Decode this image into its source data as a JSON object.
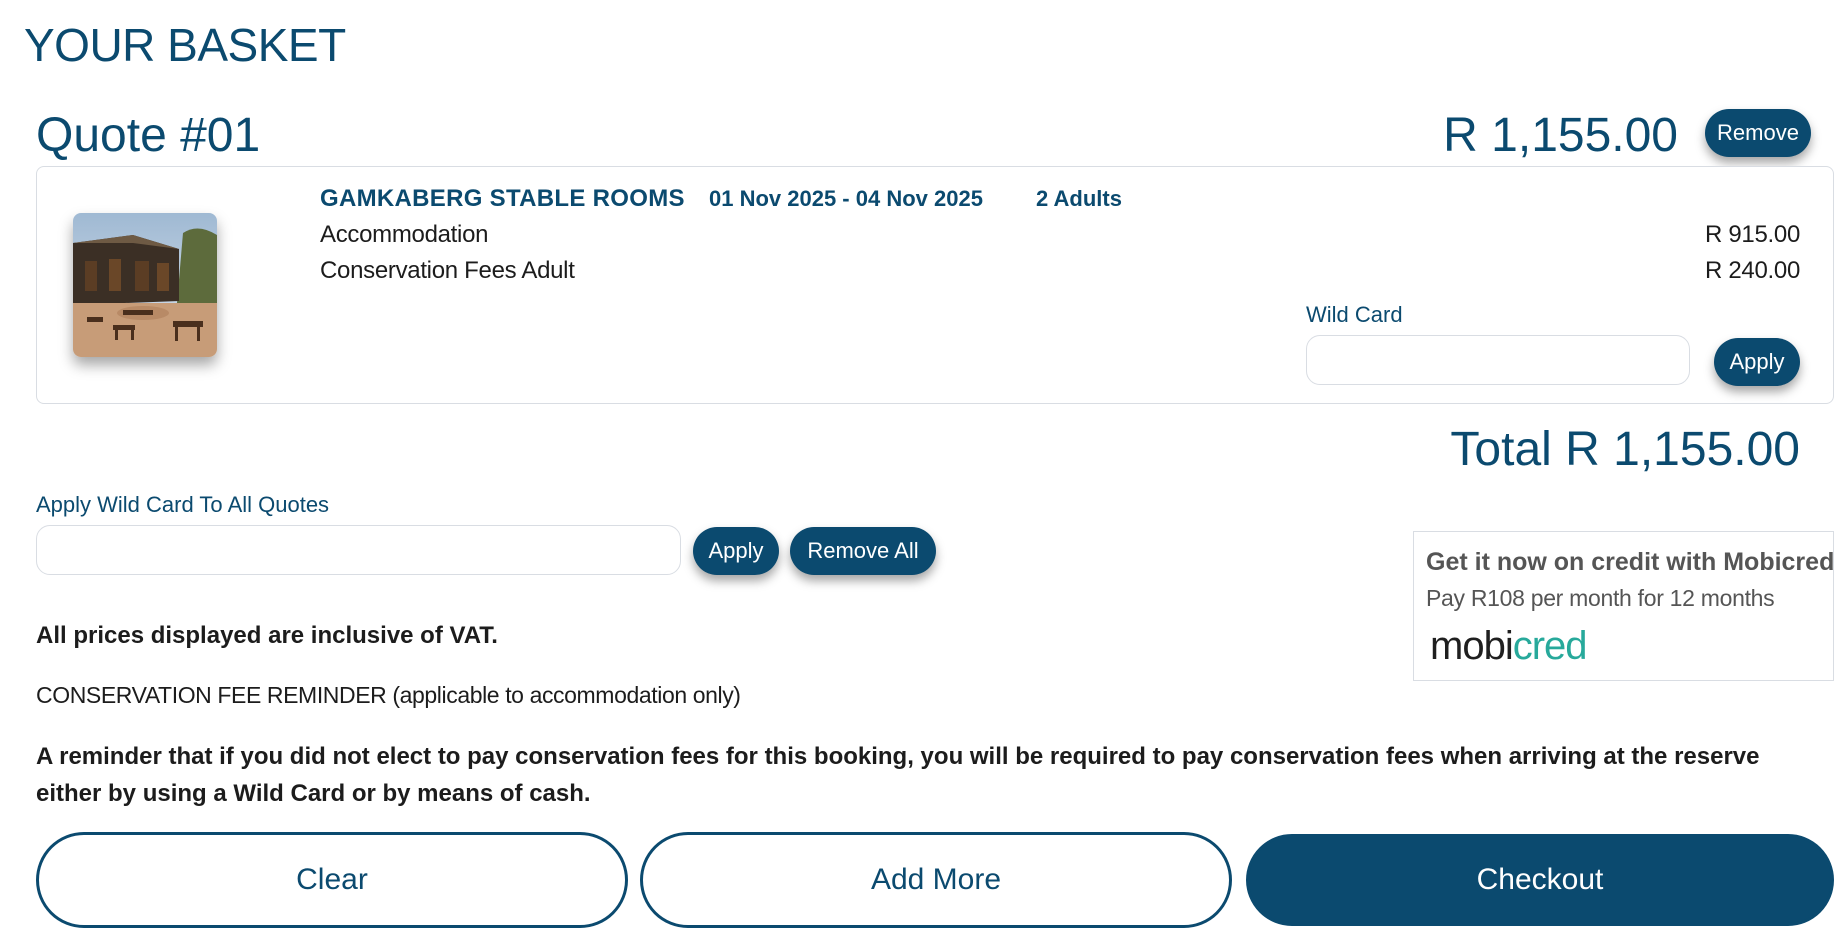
{
  "page": {
    "title": "YOUR BASKET"
  },
  "quote": {
    "title": "Quote #01",
    "price": "R 1,155.00",
    "remove_label": "Remove",
    "venue": "GAMKABERG STABLE ROOMS",
    "dates": "01 Nov 2025 - 04 Nov 2025",
    "guests": "2 Adults",
    "lines": [
      {
        "label": "Accommodation",
        "amount": "R 915.00"
      },
      {
        "label": "Conservation Fees Adult",
        "amount": "R 240.00"
      }
    ],
    "wild_card_label": "Wild Card",
    "wild_card_value": "",
    "apply_label": "Apply"
  },
  "total": "Total R 1,155.00",
  "apply_all": {
    "label": "Apply Wild Card To All Quotes",
    "value": "",
    "apply_label": "Apply",
    "remove_all_label": "Remove All"
  },
  "mobicred": {
    "title": "Get it now on credit with Mobicred",
    "subtitle": "Pay R108 per month for 12 months",
    "logo_part1": "mobi",
    "logo_part2": "cred"
  },
  "notes": {
    "vat": "All prices displayed are inclusive of VAT.",
    "reminder_title": "CONSERVATION FEE REMINDER (applicable to accommodation only)",
    "reminder_body": "A reminder that if you did not elect to pay conservation fees for this booking, you will be required to pay conservation fees when arriving at the reserve either by using a Wild Card or by means of cash."
  },
  "actions": {
    "clear": "Clear",
    "add_more": "Add More",
    "checkout": "Checkout"
  },
  "colors": {
    "brand": "#0b4a6f",
    "mobicred_accent": "#27a99b"
  }
}
